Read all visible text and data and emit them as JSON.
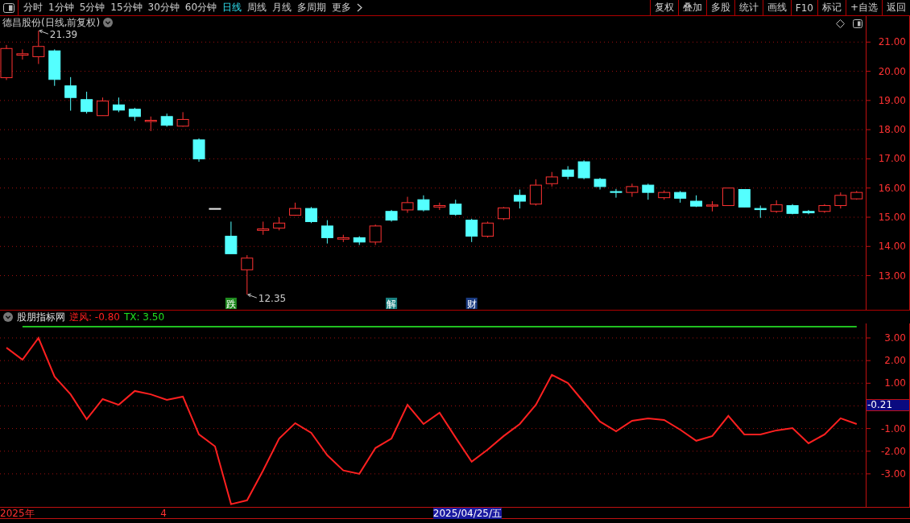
{
  "toolbar": {
    "periods": [
      {
        "label": "分时",
        "selected": false
      },
      {
        "label": "1分钟",
        "selected": false
      },
      {
        "label": "5分钟",
        "selected": false
      },
      {
        "label": "15分钟",
        "selected": false
      },
      {
        "label": "30分钟",
        "selected": false
      },
      {
        "label": "60分钟",
        "selected": false
      },
      {
        "label": "日线",
        "selected": true
      },
      {
        "label": "周线",
        "selected": false
      },
      {
        "label": "月线",
        "selected": false
      },
      {
        "label": "多周期",
        "selected": false
      },
      {
        "label": "更多",
        "selected": false
      }
    ],
    "actions": [
      "复权",
      "叠加",
      "多股",
      "统计",
      "画线",
      "F10",
      "标记",
      "+自选",
      "返回"
    ]
  },
  "chart": {
    "title": "德昌股份(日线,前复权)",
    "chart_data": {
      "type": "candlestick",
      "ylim": [
        11.83,
        21.89
      ],
      "grid": true,
      "yticks": [
        {
          "value": 13,
          "label": "13.00"
        },
        {
          "value": 14,
          "label": "14.00"
        },
        {
          "value": 15,
          "label": "15.00"
        },
        {
          "value": 16,
          "label": "16.00"
        },
        {
          "value": 17,
          "label": "17.00"
        },
        {
          "value": 18,
          "label": "18.00"
        },
        {
          "value": 19,
          "label": "19.00"
        },
        {
          "value": 20,
          "label": "20.00"
        },
        {
          "value": 21,
          "label": "21.00"
        }
      ],
      "ohlc": [
        [
          19.78,
          20.9,
          19.7,
          20.78
        ],
        [
          20.55,
          20.75,
          20.4,
          20.6
        ],
        [
          20.5,
          21.39,
          20.25,
          20.85
        ],
        [
          20.7,
          20.75,
          19.5,
          19.72
        ],
        [
          19.5,
          19.8,
          18.65,
          19.1
        ],
        [
          19.03,
          19.3,
          18.55,
          18.62
        ],
        [
          18.48,
          19.1,
          18.48,
          18.98
        ],
        [
          18.85,
          19.1,
          18.6,
          18.67
        ],
        [
          18.7,
          18.75,
          18.3,
          18.45
        ],
        [
          18.28,
          18.45,
          17.95,
          18.32
        ],
        [
          18.45,
          18.55,
          18.1,
          18.15
        ],
        [
          18.12,
          18.6,
          18.1,
          18.35
        ],
        [
          17.65,
          17.7,
          16.9,
          17.0
        ],
        [
          15.3,
          15.3,
          15.3,
          15.3
        ],
        [
          14.35,
          14.85,
          13.75,
          13.75
        ],
        [
          13.2,
          13.7,
          12.35,
          13.6
        ],
        [
          14.55,
          14.85,
          14.4,
          14.6
        ],
        [
          14.63,
          15.0,
          14.55,
          14.8
        ],
        [
          15.07,
          15.5,
          15.05,
          15.3
        ],
        [
          15.3,
          15.35,
          14.8,
          14.85
        ],
        [
          14.7,
          14.9,
          14.1,
          14.3
        ],
        [
          14.25,
          14.4,
          14.15,
          14.3
        ],
        [
          14.3,
          14.35,
          14.05,
          14.15
        ],
        [
          14.15,
          14.75,
          14.05,
          14.7
        ],
        [
          15.2,
          15.25,
          14.85,
          14.9
        ],
        [
          15.25,
          15.7,
          15.15,
          15.5
        ],
        [
          15.6,
          15.75,
          15.2,
          15.25
        ],
        [
          15.35,
          15.5,
          15.25,
          15.4
        ],
        [
          15.45,
          15.6,
          15.05,
          15.1
        ],
        [
          14.9,
          14.95,
          14.15,
          14.35
        ],
        [
          14.35,
          14.85,
          14.3,
          14.8
        ],
        [
          14.95,
          15.35,
          14.9,
          15.32
        ],
        [
          15.75,
          15.95,
          15.3,
          15.55
        ],
        [
          15.45,
          16.3,
          15.4,
          16.1
        ],
        [
          16.15,
          16.55,
          16.05,
          16.38
        ],
        [
          16.62,
          16.75,
          16.3,
          16.4
        ],
        [
          16.9,
          16.95,
          16.3,
          16.35
        ],
        [
          16.3,
          16.35,
          15.95,
          16.05
        ],
        [
          15.88,
          15.97,
          15.67,
          15.85
        ],
        [
          15.85,
          16.15,
          15.7,
          16.05
        ],
        [
          16.1,
          16.15,
          15.6,
          15.85
        ],
        [
          15.67,
          15.92,
          15.6,
          15.85
        ],
        [
          15.85,
          15.9,
          15.5,
          15.65
        ],
        [
          15.55,
          15.75,
          15.35,
          15.38
        ],
        [
          15.38,
          15.55,
          15.2,
          15.42
        ],
        [
          15.4,
          16.0,
          15.4,
          16.0
        ],
        [
          15.95,
          15.95,
          15.35,
          15.35
        ],
        [
          15.3,
          15.4,
          14.98,
          15.26
        ],
        [
          15.2,
          15.58,
          15.15,
          15.43
        ],
        [
          15.4,
          15.45,
          15.1,
          15.13
        ],
        [
          15.2,
          15.25,
          15.1,
          15.15
        ],
        [
          15.2,
          15.45,
          15.15,
          15.4
        ],
        [
          15.4,
          15.85,
          15.3,
          15.75
        ],
        [
          15.63,
          15.9,
          15.6,
          15.85
        ]
      ],
      "annotations": [
        "21.39",
        "12.35"
      ]
    },
    "signals": [
      {
        "label": "跌",
        "color": "#1f8a1f"
      },
      {
        "label": "解",
        "color": "#1a8080"
      },
      {
        "label": "财",
        "color": "#1a3a80"
      }
    ]
  },
  "indicator": {
    "name": "股朋指标网",
    "readouts": [
      {
        "label": "逆风: -0.80",
        "color": "#ff2020"
      },
      {
        "label": "TX: 3.50",
        "color": "#20e020"
      }
    ],
    "chart_data": {
      "type": "line",
      "ylim": [
        -4.46,
        3.64
      ],
      "grid": true,
      "yticks": [
        {
          "value": -3,
          "label": "-3.00"
        },
        {
          "value": -2,
          "label": "-2.00"
        },
        {
          "value": -1,
          "label": "-1.00"
        },
        {
          "value": 1,
          "label": "1.00"
        },
        {
          "value": 2,
          "label": "2.00"
        },
        {
          "value": 3,
          "label": "3.00"
        }
      ],
      "series": [
        {
          "color": "#ff2020",
          "values": [
            2.57,
            2.04,
            3.0,
            1.29,
            0.51,
            -0.59,
            0.3,
            0.05,
            0.66,
            0.51,
            0.27,
            0.41,
            -1.26,
            -1.79,
            -4.34,
            -4.17,
            -2.85,
            -1.44,
            -0.76,
            -1.19,
            -2.18,
            -2.85,
            -3.0,
            -1.86,
            -1.44,
            0.05,
            -0.8,
            -0.3,
            -1.4,
            -2.46,
            -1.93,
            -1.33,
            -0.8,
            0.05,
            1.37,
            1.01,
            0.16,
            -0.69,
            -1.12,
            -0.66,
            -0.55,
            -0.62,
            -1.05,
            -1.54,
            -1.33,
            -0.44,
            -1.26,
            -1.26,
            -1.08,
            -0.98,
            -1.65,
            -1.26,
            -0.55,
            -0.8
          ]
        },
        {
          "color": "#20c020",
          "values": [
            null,
            3.5,
            3.5,
            3.5,
            3.5,
            3.5,
            3.5,
            3.5,
            3.5,
            3.5,
            3.5,
            3.5,
            3.5,
            3.5,
            3.5,
            3.5,
            3.5,
            3.5,
            3.5,
            3.5,
            3.5,
            3.5,
            3.5,
            3.5,
            3.5,
            3.5,
            3.5,
            3.5,
            3.5,
            3.5,
            3.5,
            3.5,
            3.5,
            3.5,
            3.5,
            3.5,
            3.5,
            3.5,
            3.5,
            3.5,
            3.5,
            3.5,
            3.5,
            3.5,
            3.5,
            3.5,
            3.5,
            3.5,
            3.5,
            3.5,
            3.5,
            3.5,
            3.5,
            3.5
          ]
        }
      ]
    }
  },
  "date_axis": [
    {
      "label": "2025年"
    },
    {
      "label": "4"
    }
  ],
  "crosshair": {
    "date": "2025/04/25/五",
    "value": "-0.21"
  }
}
